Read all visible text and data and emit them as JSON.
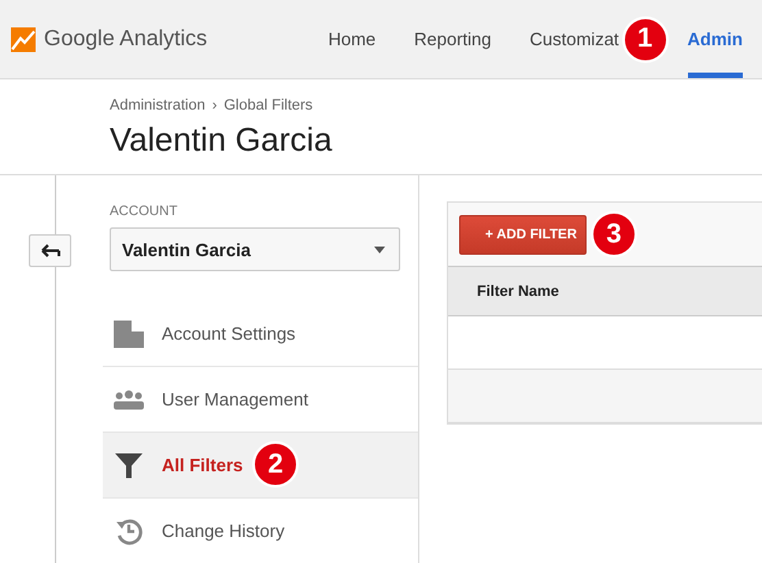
{
  "app": {
    "name": "Google Analytics"
  },
  "nav": [
    {
      "label": "Home",
      "selected": false
    },
    {
      "label": "Reporting",
      "selected": false
    },
    {
      "label": "Customizat",
      "selected": false
    },
    {
      "label": "Admin",
      "selected": true,
      "callout": "1"
    }
  ],
  "breadcrumb": [
    "Administration",
    "›",
    "Global Filters"
  ],
  "title": "Valentin Garcia",
  "account": {
    "label": "ACCOUNT",
    "value": "Valentin Garcia"
  },
  "menu": [
    {
      "label": "Account Settings",
      "selected": false
    },
    {
      "label": "User Management",
      "selected": false
    },
    {
      "label": "All Filters",
      "selected": true,
      "callout": "2"
    },
    {
      "label": "Change History",
      "selected": false
    }
  ],
  "add_button": {
    "label": "+ ADD FILTER",
    "callout": "3"
  },
  "table": {
    "columns": [
      "Filter Name"
    ]
  }
}
